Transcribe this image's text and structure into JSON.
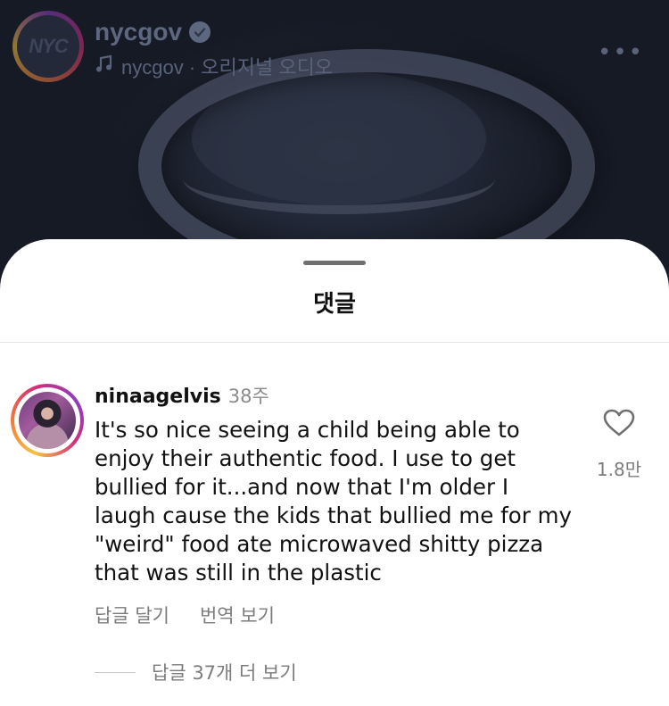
{
  "post": {
    "username": "nycgov",
    "avatar_text": "NYC",
    "audio_text": "nycgov · 오리지널 오디오",
    "icons": {
      "verified": "verified-badge-icon",
      "audio": "music-note-icon",
      "more": "more-options-icon"
    }
  },
  "sheet": {
    "title": "댓글"
  },
  "comment": {
    "username": "ninaagelvis",
    "time": "38주",
    "text": "It's so nice seeing a child being able to enjoy their authentic food. I use to get bullied for it...and now that I'm older I laugh cause the kids that bullied me for my \"weird\" food ate microwaved shitty pizza that was still in the plastic",
    "like_count": "1.8만",
    "actions": {
      "reply": "답글 달기",
      "translate": "번역 보기"
    },
    "view_replies": "답글 37개 더 보기",
    "icons": {
      "like": "heart-outline-icon"
    }
  }
}
